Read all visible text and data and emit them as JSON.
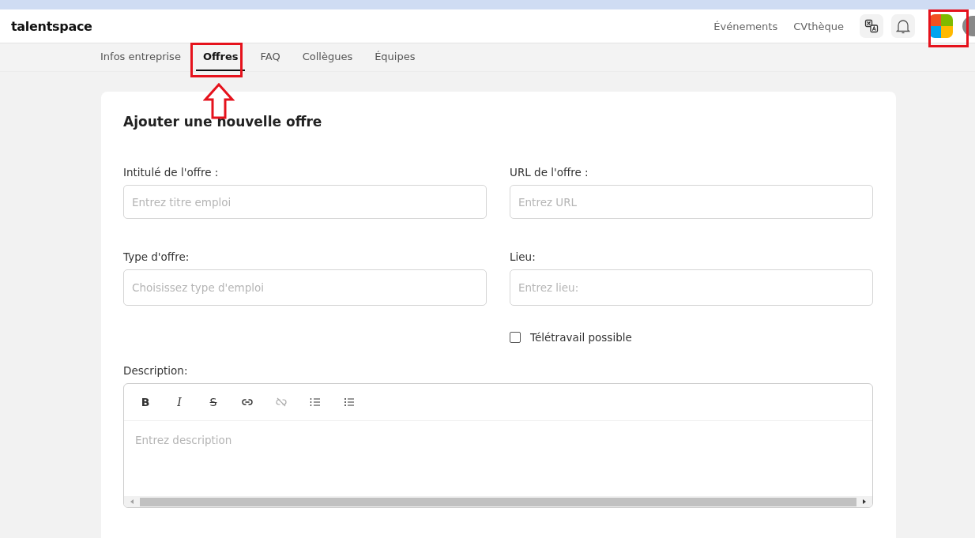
{
  "header": {
    "logo": "talentspace",
    "links": [
      {
        "label": "Événements"
      },
      {
        "label": "CVthèque"
      }
    ]
  },
  "tabs": [
    {
      "label": "Infos entreprise",
      "selected": false
    },
    {
      "label": "Offres",
      "selected": true
    },
    {
      "label": "FAQ",
      "selected": false
    },
    {
      "label": "Collègues",
      "selected": false
    },
    {
      "label": "Équipes",
      "selected": false
    }
  ],
  "form": {
    "title": "Ajouter une nouvelle offre",
    "fields": [
      {
        "label": "Intitulé de l'offre :",
        "placeholder": "Entrez titre emploi"
      },
      {
        "label": "URL de l'offre :",
        "placeholder": "Entrez URL"
      },
      {
        "label": "Type d'offre:",
        "placeholder": "Choisissez type d'emploi"
      },
      {
        "label": "Lieu:",
        "placeholder": "Entrez lieu:"
      }
    ],
    "remote": {
      "label": "Télétravail possible",
      "checked": false
    },
    "description": {
      "label": "Description:",
      "placeholder": "Entrez description",
      "toolbar": [
        {
          "kind": "bold",
          "label": "B",
          "disabled": false
        },
        {
          "kind": "italic",
          "label": "I",
          "disabled": false
        },
        {
          "kind": "strike",
          "label": "S",
          "disabled": false
        },
        {
          "kind": "link",
          "disabled": false
        },
        {
          "kind": "unlink",
          "disabled": true
        },
        {
          "kind": "ordered",
          "disabled": false
        },
        {
          "kind": "bullet",
          "disabled": false
        }
      ]
    }
  }
}
